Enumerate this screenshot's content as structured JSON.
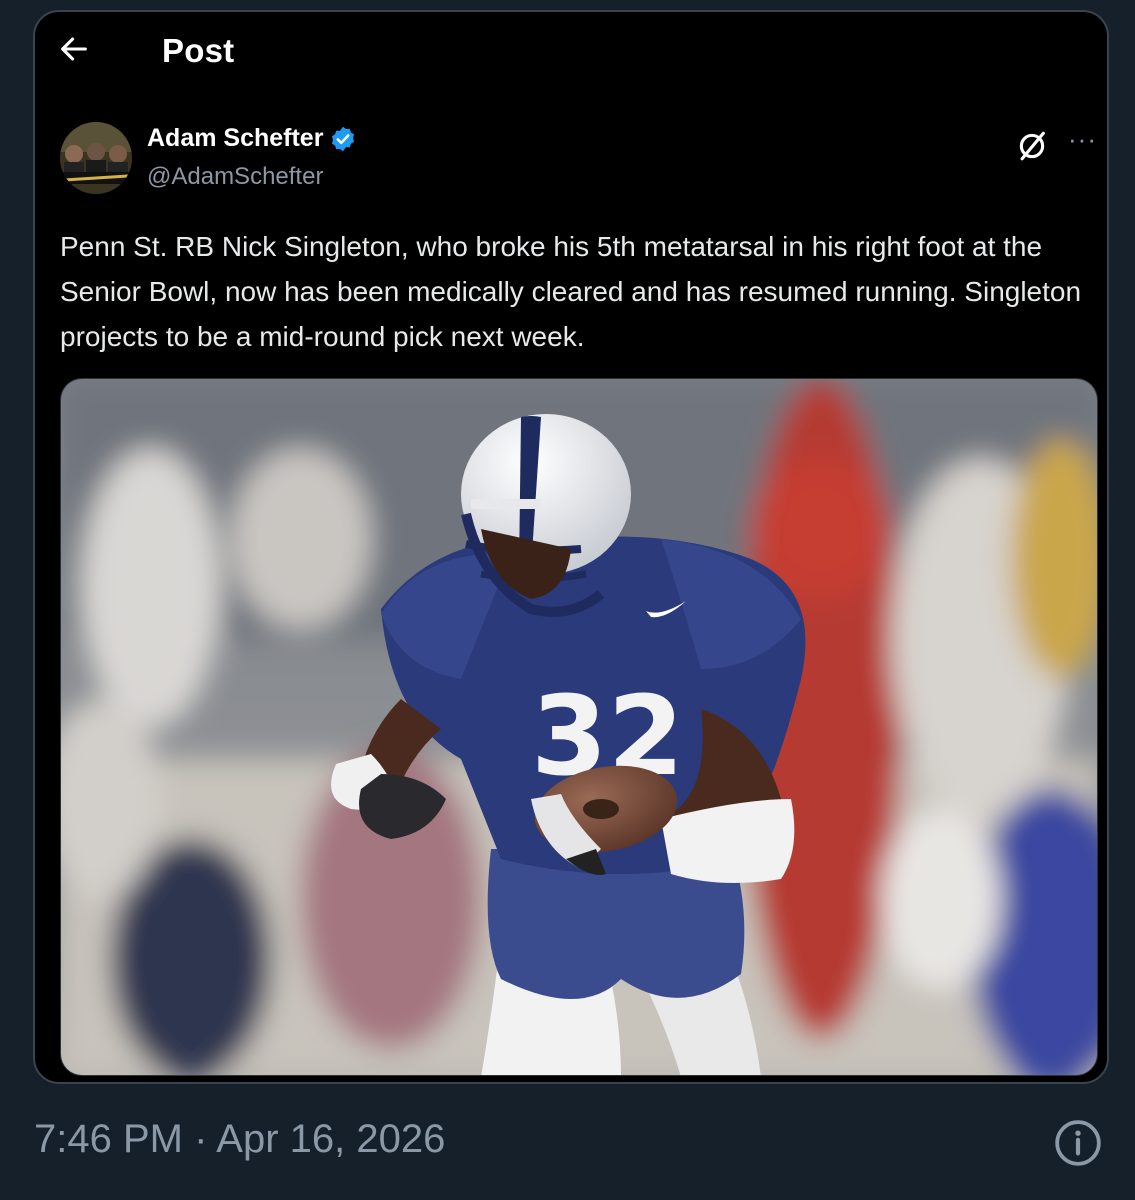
{
  "header": {
    "title": "Post",
    "back_icon": "arrow-left-icon"
  },
  "author": {
    "name": "Adam Schefter",
    "handle": "@AdamSchefter",
    "verified_icon": "verified-badge-icon",
    "verified_color": "#1d9bf0"
  },
  "actions": {
    "grok_icon": "grok-icon",
    "more_label": "···"
  },
  "post": {
    "text": "Penn St. RB Nick Singleton, who broke his 5th metatarsal in his right foot at the Senior Bowl, now has been medically cleared and has resumed running. Singleton projects to be a mid-round pick next week.",
    "media_jersey_number": "32"
  },
  "footer": {
    "timestamp": "7:46 PM · Apr 16, 2026",
    "info_icon": "info-icon"
  },
  "colors": {
    "background": "#15202b",
    "card": "#000000",
    "secondary_text": "#8b98a5",
    "accent": "#1d9bf0"
  }
}
